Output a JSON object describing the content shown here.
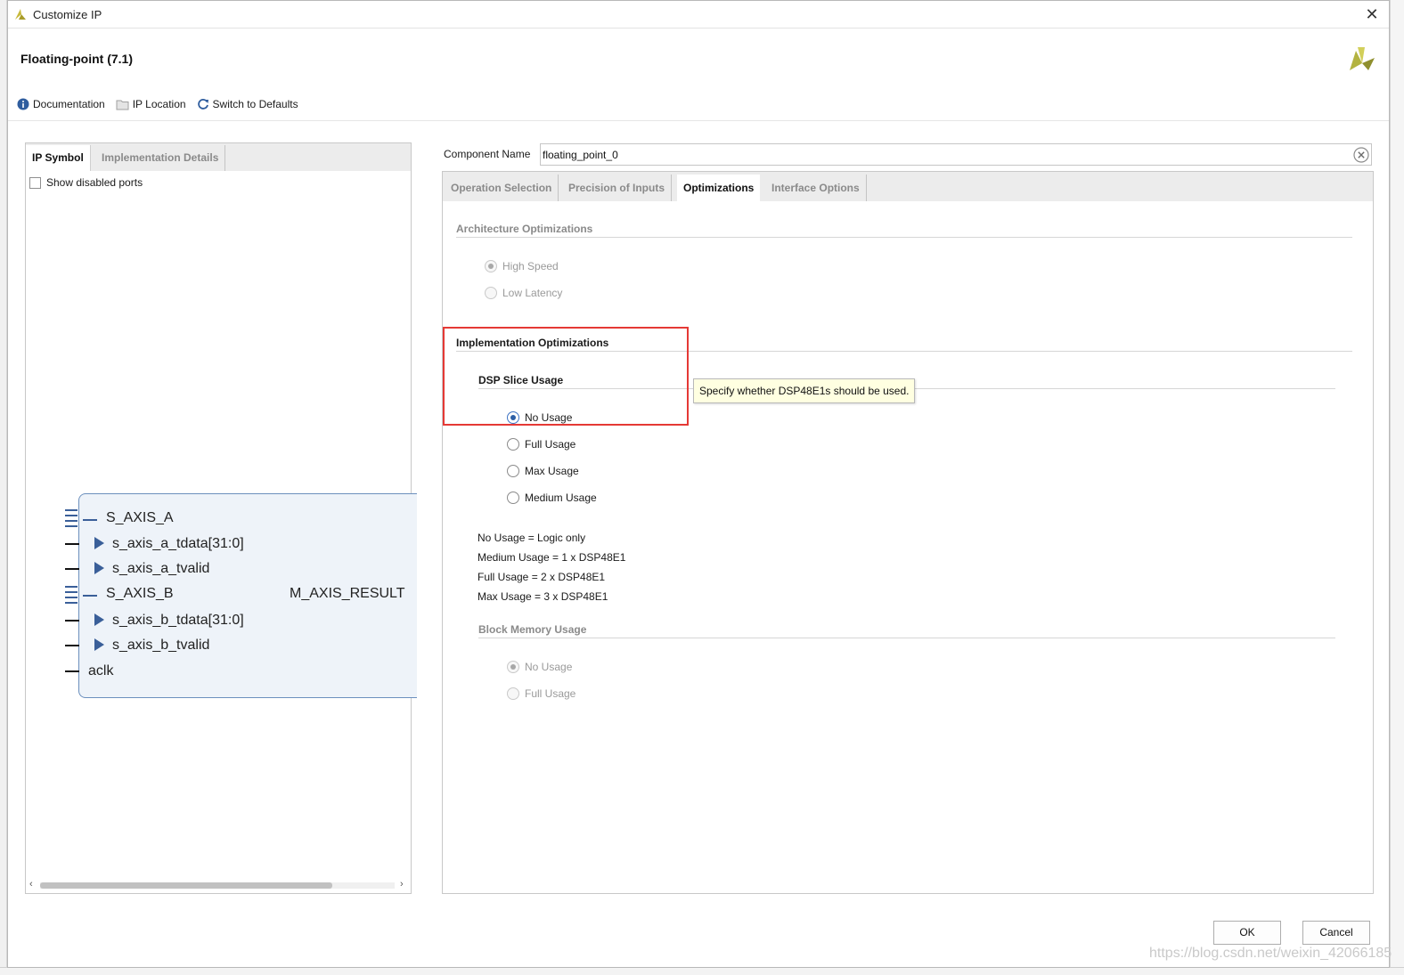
{
  "window": {
    "title": "Customize IP",
    "close_glyph": "✕"
  },
  "header": {
    "title": "Floating-point (7.1)",
    "logo_icon": "xilinx-logo"
  },
  "toolbar": {
    "documentation": "Documentation",
    "ip_location": "IP Location",
    "switch_defaults": "Switch to Defaults"
  },
  "left_panel": {
    "tabs": [
      {
        "label": "IP Symbol",
        "active": true
      },
      {
        "label": "Implementation Details",
        "active": false
      }
    ],
    "show_disabled_ports": "Show disabled ports",
    "show_disabled_checked": false,
    "symbol": {
      "bus_a": "S_AXIS_A",
      "a_tdata": "s_axis_a_tdata[31:0]",
      "a_tvalid": "s_axis_a_tvalid",
      "bus_b": "S_AXIS_B",
      "b_tdata": "s_axis_b_tdata[31:0]",
      "b_tvalid": "s_axis_b_tvalid",
      "aclk": "aclk",
      "result": "M_AXIS_RESULT"
    }
  },
  "component": {
    "label": "Component Name",
    "value": "floating_point_0"
  },
  "right_panel": {
    "tabs": [
      {
        "label": "Operation Selection",
        "active": false
      },
      {
        "label": "Precision of Inputs",
        "active": false
      },
      {
        "label": "Optimizations",
        "active": true
      },
      {
        "label": "Interface Options",
        "active": false
      }
    ],
    "arch": {
      "title": "Architecture Optimizations",
      "options": [
        {
          "label": "High Speed",
          "checked": true,
          "enabled": false
        },
        {
          "label": "Low Latency",
          "checked": false,
          "enabled": false
        }
      ]
    },
    "impl": {
      "title": "Implementation Optimizations",
      "dsp_title": "DSP Slice Usage",
      "dsp_options": [
        {
          "label": "No Usage",
          "checked": true,
          "enabled": true
        },
        {
          "label": "Full Usage",
          "checked": false,
          "enabled": true
        },
        {
          "label": "Max Usage",
          "checked": false,
          "enabled": true
        },
        {
          "label": "Medium Usage",
          "checked": false,
          "enabled": true
        }
      ],
      "info": [
        "No Usage = Logic only",
        "Medium Usage = 1 x DSP48E1",
        "Full Usage = 2 x DSP48E1",
        "Max Usage = 3 x DSP48E1"
      ],
      "bram_title": "Block Memory Usage",
      "bram_options": [
        {
          "label": "No Usage",
          "checked": true,
          "enabled": false
        },
        {
          "label": "Full Usage",
          "checked": false,
          "enabled": false
        }
      ]
    },
    "tooltip": "Specify whether DSP48E1s should be used."
  },
  "buttons": {
    "ok": "OK",
    "cancel": "Cancel"
  },
  "watermark": "https://blog.csdn.net/weixin_42066185",
  "colors": {
    "highlight": "#e53935",
    "radio_accent": "#2d5fa6",
    "symbol_fill": "#eef3f9",
    "tooltip_bg": "#ffffe1"
  }
}
